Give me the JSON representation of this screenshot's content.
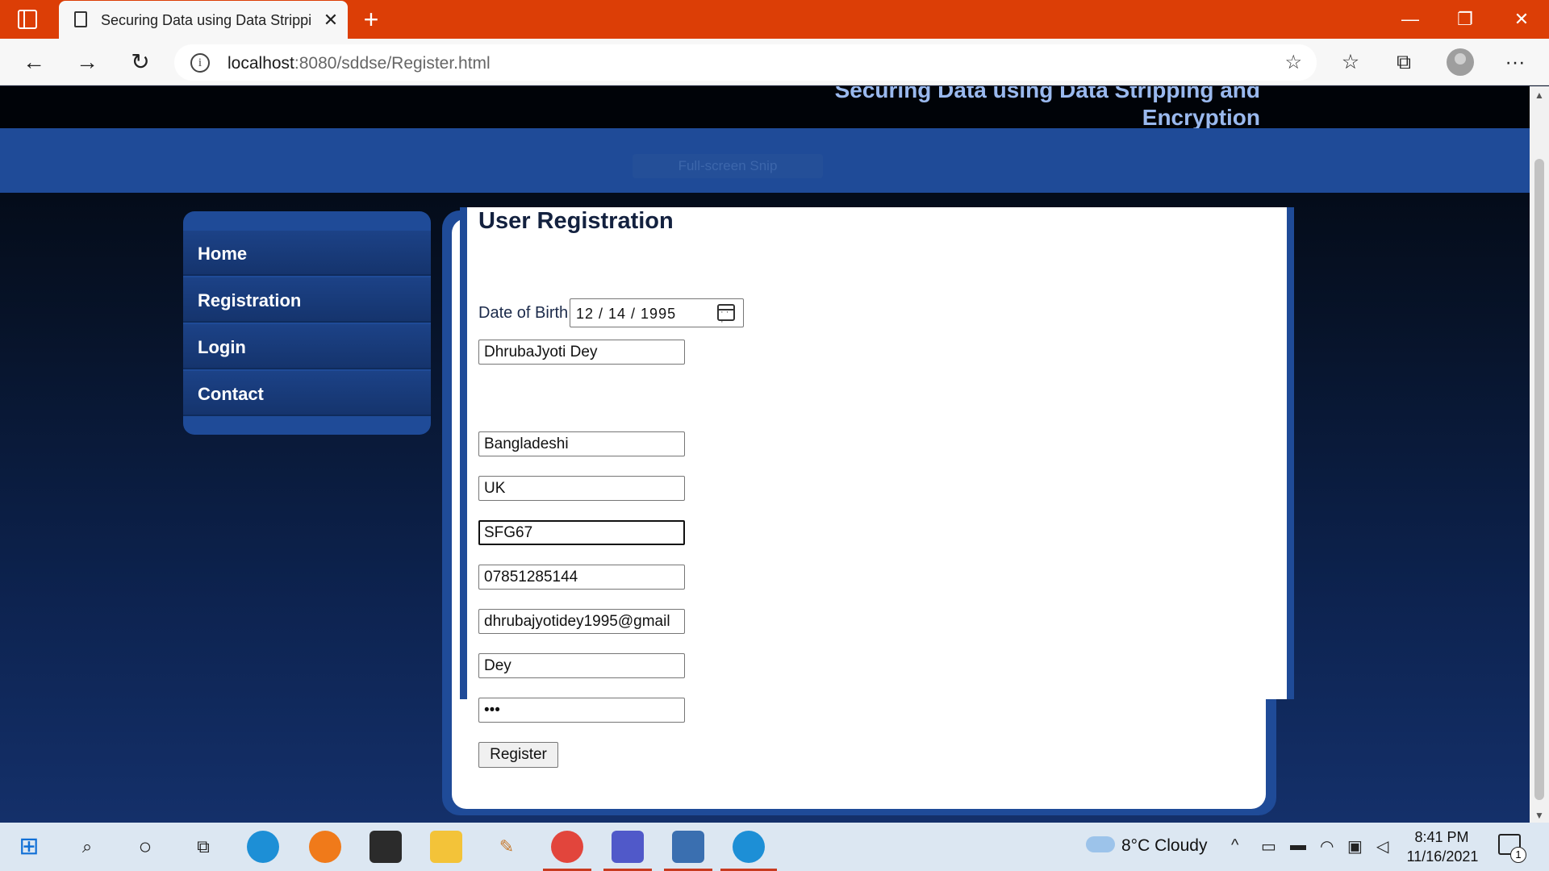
{
  "browser": {
    "tab_title": "Securing Data using Data Stripping and Encryption",
    "tab_close": "✕",
    "new_tab": "+",
    "url_host": "localhost",
    "url_rest": ":8080/sddse/Register.html",
    "window_controls": {
      "minimize": "—",
      "restore": "❐",
      "close": "✕"
    },
    "nav": {
      "back": "←",
      "forward": "→",
      "reload": "↻"
    },
    "tools": {
      "favorites": "☆",
      "collections": "⧉",
      "more": "···"
    }
  },
  "site": {
    "title_line1": "Securing Data using Data Stripping and",
    "title_line2": "Encryption",
    "fullscreen_tip": "Full-screen Snip"
  },
  "menu": {
    "items": [
      {
        "label": "Home"
      },
      {
        "label": "Registration"
      },
      {
        "label": "Login"
      },
      {
        "label": "Contact"
      }
    ]
  },
  "form": {
    "title": "User Registration",
    "name": "DhrubaJyoti Dey",
    "dob_label": "Date of Birth",
    "dob_value": "12 / 14 / 1995",
    "nationality": "Bangladeshi",
    "country": "UK",
    "postcode": "SFG67",
    "phone": "07851285144",
    "email": "dhrubajyotidey1995@gmail",
    "username": "Dey",
    "password": "•••",
    "register_label": "Register"
  },
  "taskbar": {
    "weather": "8°C  Cloudy",
    "time": "8:41 PM",
    "date": "11/16/2021",
    "notification_count": "1"
  },
  "colors": {
    "titlebar": "#dc3e06",
    "banner": "#1f4b98",
    "taskbar": "#dce7f2"
  }
}
